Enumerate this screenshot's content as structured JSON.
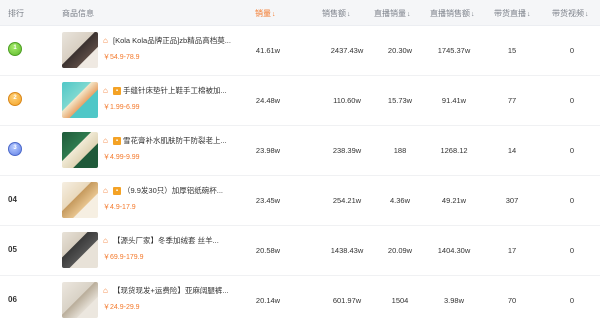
{
  "columns": {
    "rank": "排行",
    "product": "商品信息",
    "sales": "销量",
    "sales_amount": "销售额",
    "live_sales": "直播销量",
    "live_amount": "直播销售额",
    "live_streams": "带货直播",
    "videos": "带货视频"
  },
  "accent_color": "#f4782a",
  "rows": [
    {
      "rank": "",
      "medal": "gold",
      "title": "[Kola Kola品牌正品]zb精品高档莫...",
      "price": "￥54.9-78.9",
      "sales": "41.61w",
      "amount": "2437.43w",
      "live_sales": "20.30w",
      "live_amount": "1745.37w",
      "streams": "15",
      "videos": "0"
    },
    {
      "rank": "",
      "medal": "orange",
      "title": "手缝针床垫针上鞋手工棉被加...",
      "price": "￥1.99-6.99",
      "sales": "24.48w",
      "amount": "110.60w",
      "live_sales": "15.73w",
      "live_amount": "91.41w",
      "streams": "77",
      "videos": "0"
    },
    {
      "rank": "",
      "medal": "blue",
      "title": "雪花膏补水肌肤防干防裂老上...",
      "price": "￥4.99-9.99",
      "sales": "23.98w",
      "amount": "238.39w",
      "live_sales": "188",
      "live_amount": "1268.12",
      "streams": "14",
      "videos": "0"
    },
    {
      "rank": "04",
      "medal": "",
      "title": "（9.9发30只）加厚铝纸碗杯...",
      "price": "￥4.9-17.9",
      "sales": "23.45w",
      "amount": "254.21w",
      "live_sales": "4.36w",
      "live_amount": "49.21w",
      "streams": "307",
      "videos": "0"
    },
    {
      "rank": "05",
      "medal": "",
      "title": "【源头厂家】冬季加绒套 丝羊...",
      "price": "￥69.9-179.9",
      "sales": "20.58w",
      "amount": "1438.43w",
      "live_sales": "20.09w",
      "live_amount": "1404.30w",
      "streams": "17",
      "videos": "0"
    },
    {
      "rank": "06",
      "medal": "",
      "title": "【现货现发+运费险】亚麻阔腿裤...",
      "price": "￥24.9-29.9",
      "sales": "20.14w",
      "amount": "601.97w",
      "live_sales": "1504",
      "live_amount": "3.98w",
      "streams": "70",
      "videos": "0"
    }
  ]
}
